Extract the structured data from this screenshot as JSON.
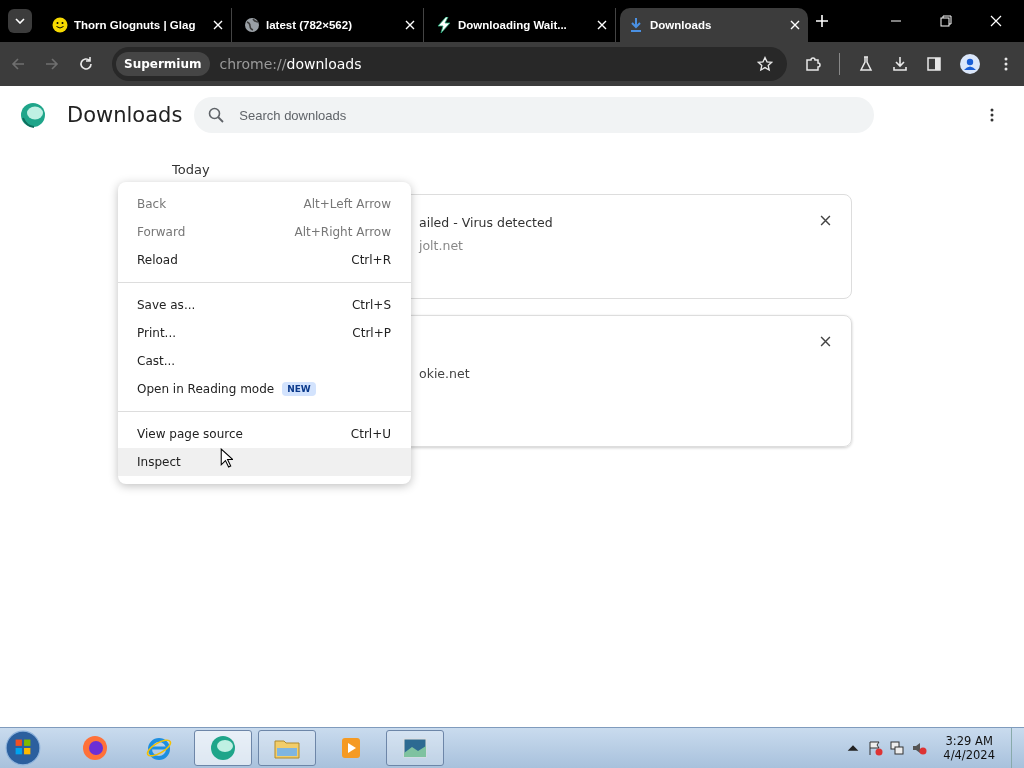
{
  "tabs": [
    {
      "title": "Thorn Glognuts | Glag",
      "selected": false
    },
    {
      "title": "latest (782×562)",
      "selected": false
    },
    {
      "title": "Downloading Wait...",
      "selected": false
    },
    {
      "title": "Downloads",
      "selected": true
    }
  ],
  "toolbar": {
    "back_disabled": true,
    "forward_disabled": true,
    "site_chip": "Supermium",
    "url_prefix": "chrome://",
    "url_path": "downloads"
  },
  "page": {
    "title": "Downloads",
    "search": {
      "placeholder": "Search downloads"
    },
    "section": "Today",
    "cards": [
      {
        "lines": [
          {
            "text": "ailed - Virus detected",
            "kind": "status"
          },
          {
            "text": "jolt.net",
            "kind": "source"
          }
        ]
      },
      {
        "lines": [
          {
            "text": "okie.net",
            "kind": "url"
          }
        ]
      }
    ]
  },
  "context_menu": {
    "groups": [
      [
        {
          "label": "Back",
          "shortcut": "Alt+Left Arrow",
          "disabled": true,
          "selected": false
        },
        {
          "label": "Forward",
          "shortcut": "Alt+Right Arrow",
          "disabled": true,
          "selected": false
        },
        {
          "label": "Reload",
          "shortcut": "Ctrl+R",
          "disabled": false,
          "selected": false
        }
      ],
      [
        {
          "label": "Save as...",
          "shortcut": "Ctrl+S",
          "disabled": false,
          "selected": false
        },
        {
          "label": "Print...",
          "shortcut": "Ctrl+P",
          "disabled": false,
          "selected": false
        },
        {
          "label": "Cast...",
          "disabled": false,
          "selected": false
        },
        {
          "label": "Open in Reading mode",
          "badge": "NEW",
          "disabled": false,
          "selected": false
        }
      ],
      [
        {
          "label": "View page source",
          "shortcut": "Ctrl+U",
          "disabled": false,
          "selected": false
        },
        {
          "label": "Inspect",
          "disabled": false,
          "selected": true
        }
      ]
    ]
  },
  "taskbar": {
    "apps": [
      {
        "running": false,
        "selected": false
      },
      {
        "running": false,
        "selected": false
      },
      {
        "running": true,
        "selected": true
      },
      {
        "running": true,
        "selected": false
      },
      {
        "running": false,
        "selected": false
      },
      {
        "running": true,
        "selected": false
      }
    ],
    "time": "3:29 AM",
    "date": "4/4/2024"
  }
}
